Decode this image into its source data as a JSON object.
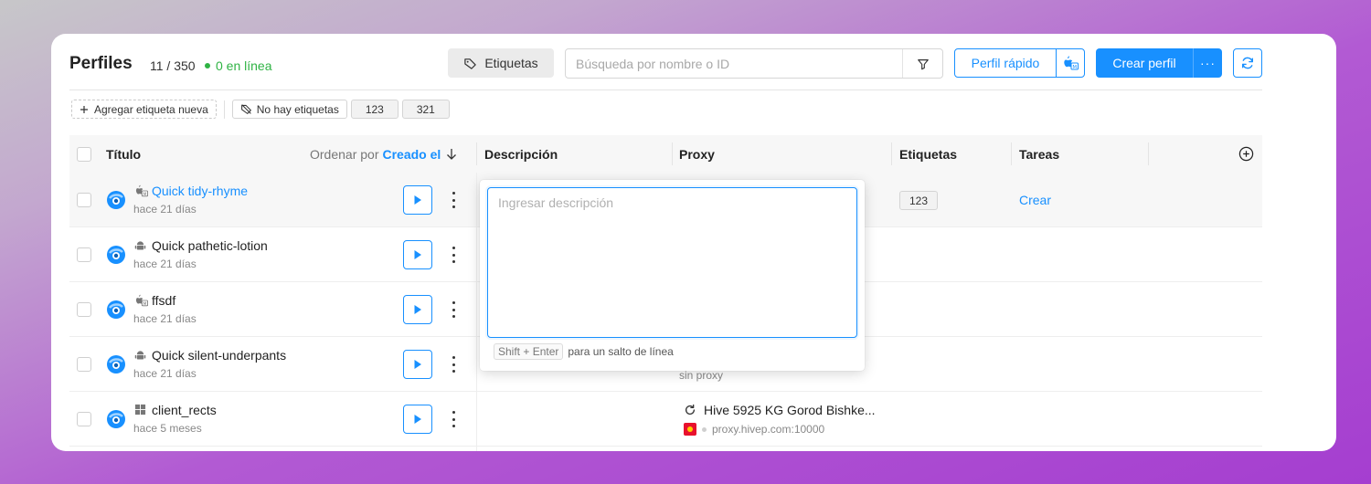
{
  "header": {
    "title": "Perfiles",
    "count": "11 / 350",
    "online": "0 en línea",
    "tags_button": "Etiquetas",
    "search_placeholder": "Búsqueda por nombre o ID",
    "quick_profile": "Perfil rápido",
    "create_profile": "Crear perfil",
    "more": "···"
  },
  "tagbar": {
    "add_tag": "Agregar etiqueta nueva",
    "no_tags": "No hay etiquetas",
    "tags": [
      "123",
      "321"
    ]
  },
  "table": {
    "columns": {
      "title": "Título",
      "sort_by": "Ordenar por",
      "sort_field": "Creado el",
      "description": "Descripción",
      "proxy": "Proxy",
      "tags": "Etiquetas",
      "tasks": "Tareas"
    },
    "rows": [
      {
        "name": "Quick tidy-rhyme",
        "created": "hace 21 días",
        "os_icon": "macos-m-icon",
        "tag": "123",
        "task": "Crear"
      },
      {
        "name": "Quick pathetic-lotion",
        "created": "hace 21 días",
        "os_icon": "android-icon"
      },
      {
        "name": "ffsdf",
        "created": "hace 21 días",
        "os_icon": "macos-m-icon"
      },
      {
        "name": "Quick silent-underpants",
        "created": "hace 21 días",
        "os_icon": "android-icon",
        "proxy_none": "sin proxy"
      },
      {
        "name": "client_rects",
        "created": "hace 5 meses",
        "os_icon": "windows-icon",
        "proxy_name": "Hive 5925 KG Gorod Bishke...",
        "proxy_host": "proxy.hivep.com:10000"
      }
    ]
  },
  "popover": {
    "placeholder": "Ingresar descripción",
    "hint_key": "Shift + Enter",
    "hint_text": "para un salto de línea"
  },
  "colors": {
    "accent": "#1890ff",
    "online": "#2fb344"
  }
}
